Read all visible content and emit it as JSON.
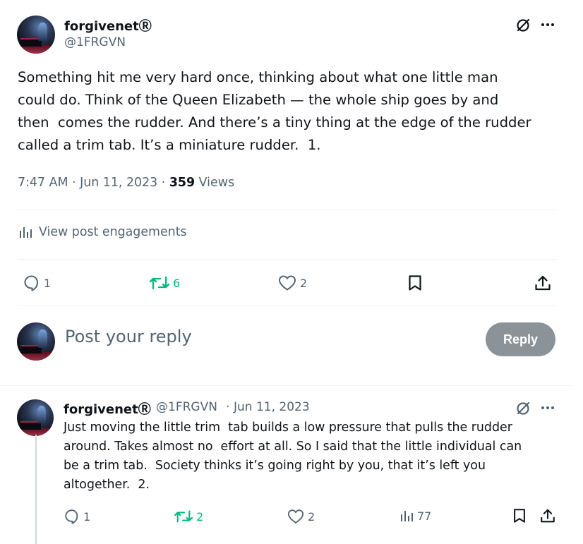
{
  "tweet": {
    "author_name": "forgivenetⓇ",
    "author_handle": "@1FRGVN",
    "text": "Something hit me very hard once, thinking about what one little man\ncould do. Think of the Queen Elizabeth — the whole ship goes by and\nthen  comes the rudder. And there’s a tiny thing at the edge of the rudder\ncalled a trim tab. It’s a miniature rudder.  1.",
    "time": "7:47 AM",
    "date": "Jun 11, 2023",
    "views_count": "359",
    "views_label": "Views",
    "engagements_label": "View post engagements",
    "actions": {
      "replies": "1",
      "reposts": "6",
      "likes": "2"
    }
  },
  "composer": {
    "placeholder": "Post your reply",
    "reply_button": "Reply"
  },
  "reply": {
    "author_name": "forgivenetⓇ",
    "author_handle": "@1FRGVN",
    "date": "Jun 11, 2023",
    "text": "Just moving the little trim  tab builds a low pressure that pulls the rudder\naround. Takes almost no  effort at all. So I said that the little individual can\nbe a trim tab.  Society thinks it’s going right by you, that it’s left you\naltogether.  2.",
    "actions": {
      "replies": "1",
      "reposts": "2",
      "likes": "2",
      "views": "77"
    }
  },
  "icons": {
    "grok": "grok-slash-icon",
    "more": "more-dots-icon",
    "reply": "speech-bubble-icon",
    "repost": "repost-arrows-icon",
    "like": "heart-icon",
    "bookmark": "bookmark-icon",
    "share": "share-upload-icon",
    "analytics": "bar-chart-icon"
  },
  "colors": {
    "text": "#0f1419",
    "secondary": "#536471",
    "repost_green": "#00ba7c",
    "reply_button_disabled": "#8b9399",
    "divider": "#eff3f4"
  }
}
